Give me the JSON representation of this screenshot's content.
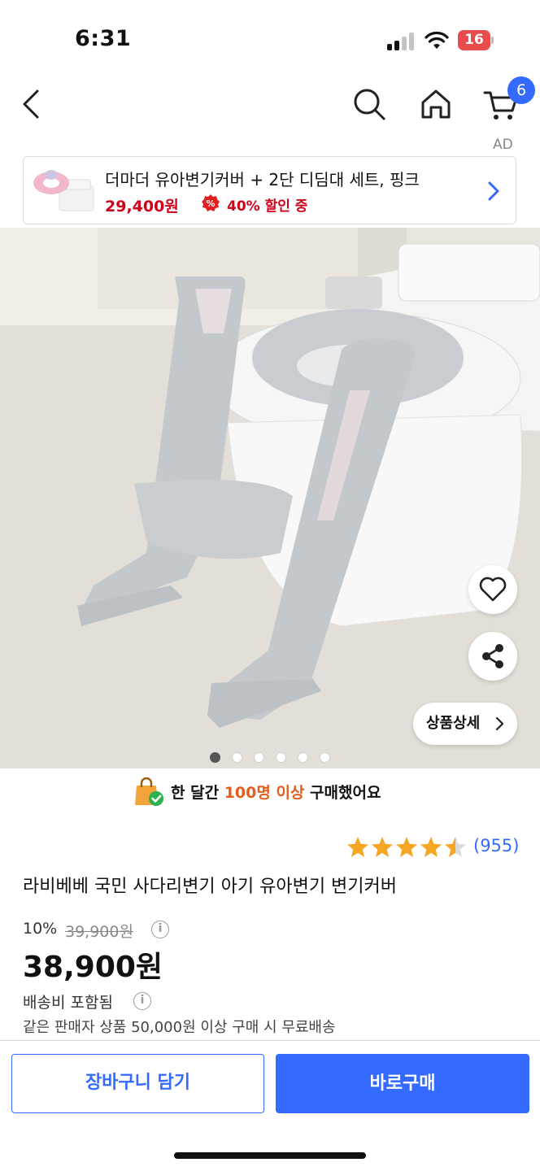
{
  "status_bar": {
    "time": "6:31",
    "battery_level": "16"
  },
  "nav": {
    "icons": [
      "back-chevron-icon",
      "search-icon",
      "home-icon",
      "cart-icon"
    ],
    "cart_count": "6",
    "ad_label": "AD"
  },
  "ad_banner": {
    "title": "더마더 유아변기커버 + 2단 디딤대 세트, 핑크",
    "price": "29,400원",
    "discount": "40% 할인 중",
    "accent_color": "#d0021b"
  },
  "gallery": {
    "detail_button": "상품상세",
    "slide_count": 6,
    "active_slide": 1
  },
  "purchase_stat": {
    "prefix": "한 달간",
    "highlight": "100명 이상",
    "suffix": "구매했어요",
    "highlight_color": "#e45d1c"
  },
  "product": {
    "rating": 4.5,
    "review_count": "(955)",
    "title": "라비베베 국민 사다리변기 아기 유아변기 변기커버",
    "discount_rate": "10%",
    "original_price": "39,900원",
    "sale_price": "38,900원",
    "shipping": "배송비 포함됨",
    "shipping_note": "같은 판매자 상품 50,000원 이상 구매 시 무료배송"
  },
  "bottom_bar": {
    "add_to_cart": "장바구니 담기",
    "buy_now": "바로구매",
    "accent_color": "#346aff"
  }
}
